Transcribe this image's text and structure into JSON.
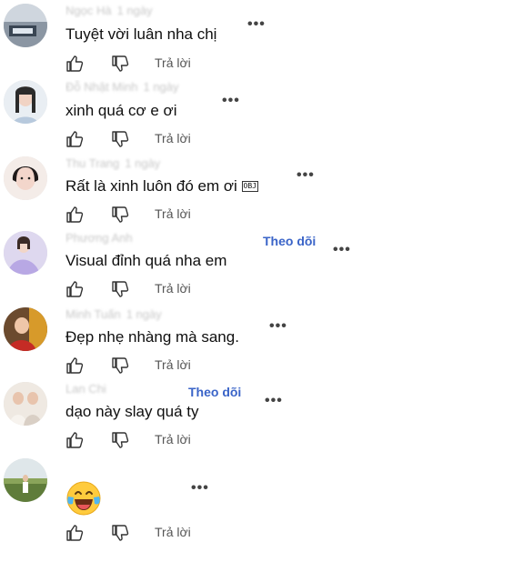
{
  "comments": [
    {
      "author": "Ngọc Hà",
      "time": "1 ngày",
      "follow": "",
      "text": "Tuyệt vời luân nha chị",
      "reply_label": "Trả lời",
      "more_label": "•••",
      "avatar_desc": "avatar-1"
    },
    {
      "author": "Đỗ Nhật Minh",
      "time": "1 ngày",
      "follow": "",
      "text": "xinh quá cơ e ơi",
      "reply_label": "Trả lời",
      "more_label": "•••",
      "avatar_desc": "avatar-2"
    },
    {
      "author": "Thu Trang",
      "time": "1 ngày",
      "follow": "",
      "text": "Rất là xinh luôn đó em ơi",
      "obj_label": "OBJ",
      "reply_label": "Trả lời",
      "more_label": "•••",
      "avatar_desc": "avatar-3"
    },
    {
      "author": "Phương Anh",
      "time": "",
      "follow": "Theo dõi",
      "text": "Visual đỉnh quá nha em",
      "reply_label": "Trả lời",
      "more_label": "•••",
      "avatar_desc": "avatar-4"
    },
    {
      "author": "Minh Tuấn",
      "time": "1 ngày",
      "follow": "",
      "text": "Đẹp nhẹ nhàng mà sang.",
      "reply_label": "Trả lời",
      "more_label": "•••",
      "avatar_desc": "avatar-5"
    },
    {
      "author": "Lan Chi",
      "time": "",
      "follow": "Theo dõi",
      "text": "dạo này slay quá ty",
      "reply_label": "Trả lời",
      "more_label": "•••",
      "avatar_desc": "avatar-6"
    },
    {
      "author": "",
      "time": "",
      "follow": "",
      "text": "",
      "emoji": "laughing-tears",
      "reply_label": "Trả lời",
      "more_label": "•••",
      "avatar_desc": "avatar-7"
    }
  ],
  "icons": {
    "like": "thumbs-up-icon",
    "dislike": "thumbs-down-icon",
    "more": "more-options-icon"
  },
  "colors": {
    "follow": "#3a64c8",
    "text": "#0f0f0f",
    "meta": "#555555"
  }
}
